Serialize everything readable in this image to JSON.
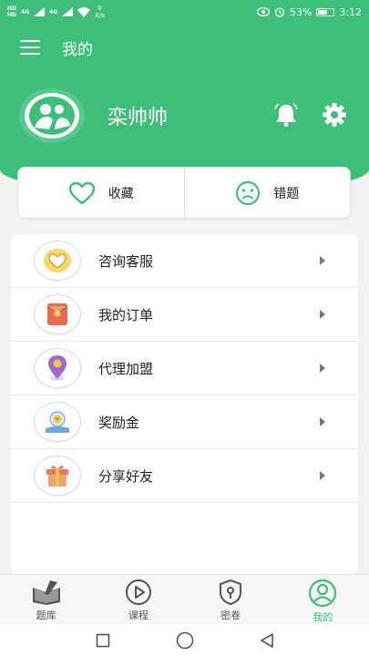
{
  "status_bar": {
    "sim1": "HD",
    "sim2": "HD",
    "network1": "4G",
    "network2": "4G",
    "net_speed_value": "0",
    "net_speed_unit": "K/s",
    "battery_percent": "53%",
    "battery_level": 0.53,
    "time": "3:12"
  },
  "header": {
    "title": "我的"
  },
  "profile": {
    "username": "栾帅帅"
  },
  "quick_actions": [
    {
      "label": "收藏",
      "icon": "heart-icon"
    },
    {
      "label": "错题",
      "icon": "sad-face-icon"
    }
  ],
  "menu": {
    "items": [
      {
        "label": "咨询客服",
        "icon": "customer-service-icon"
      },
      {
        "label": "我的订单",
        "icon": "order-icon"
      },
      {
        "label": "代理加盟",
        "icon": "location-icon"
      },
      {
        "label": "奖励金",
        "icon": "reward-icon"
      },
      {
        "label": "分享好友",
        "icon": "gift-icon"
      }
    ]
  },
  "bottom_nav": {
    "tabs": [
      {
        "label": "题库",
        "icon": "book-icon",
        "active": false
      },
      {
        "label": "课程",
        "icon": "play-icon",
        "active": false
      },
      {
        "label": "密卷",
        "icon": "lock-shield-icon",
        "active": false
      },
      {
        "label": "我的",
        "icon": "user-icon",
        "active": true
      }
    ]
  },
  "colors": {
    "accent": "#3dbf7a",
    "text": "#222222",
    "background": "#f2f2f2"
  }
}
